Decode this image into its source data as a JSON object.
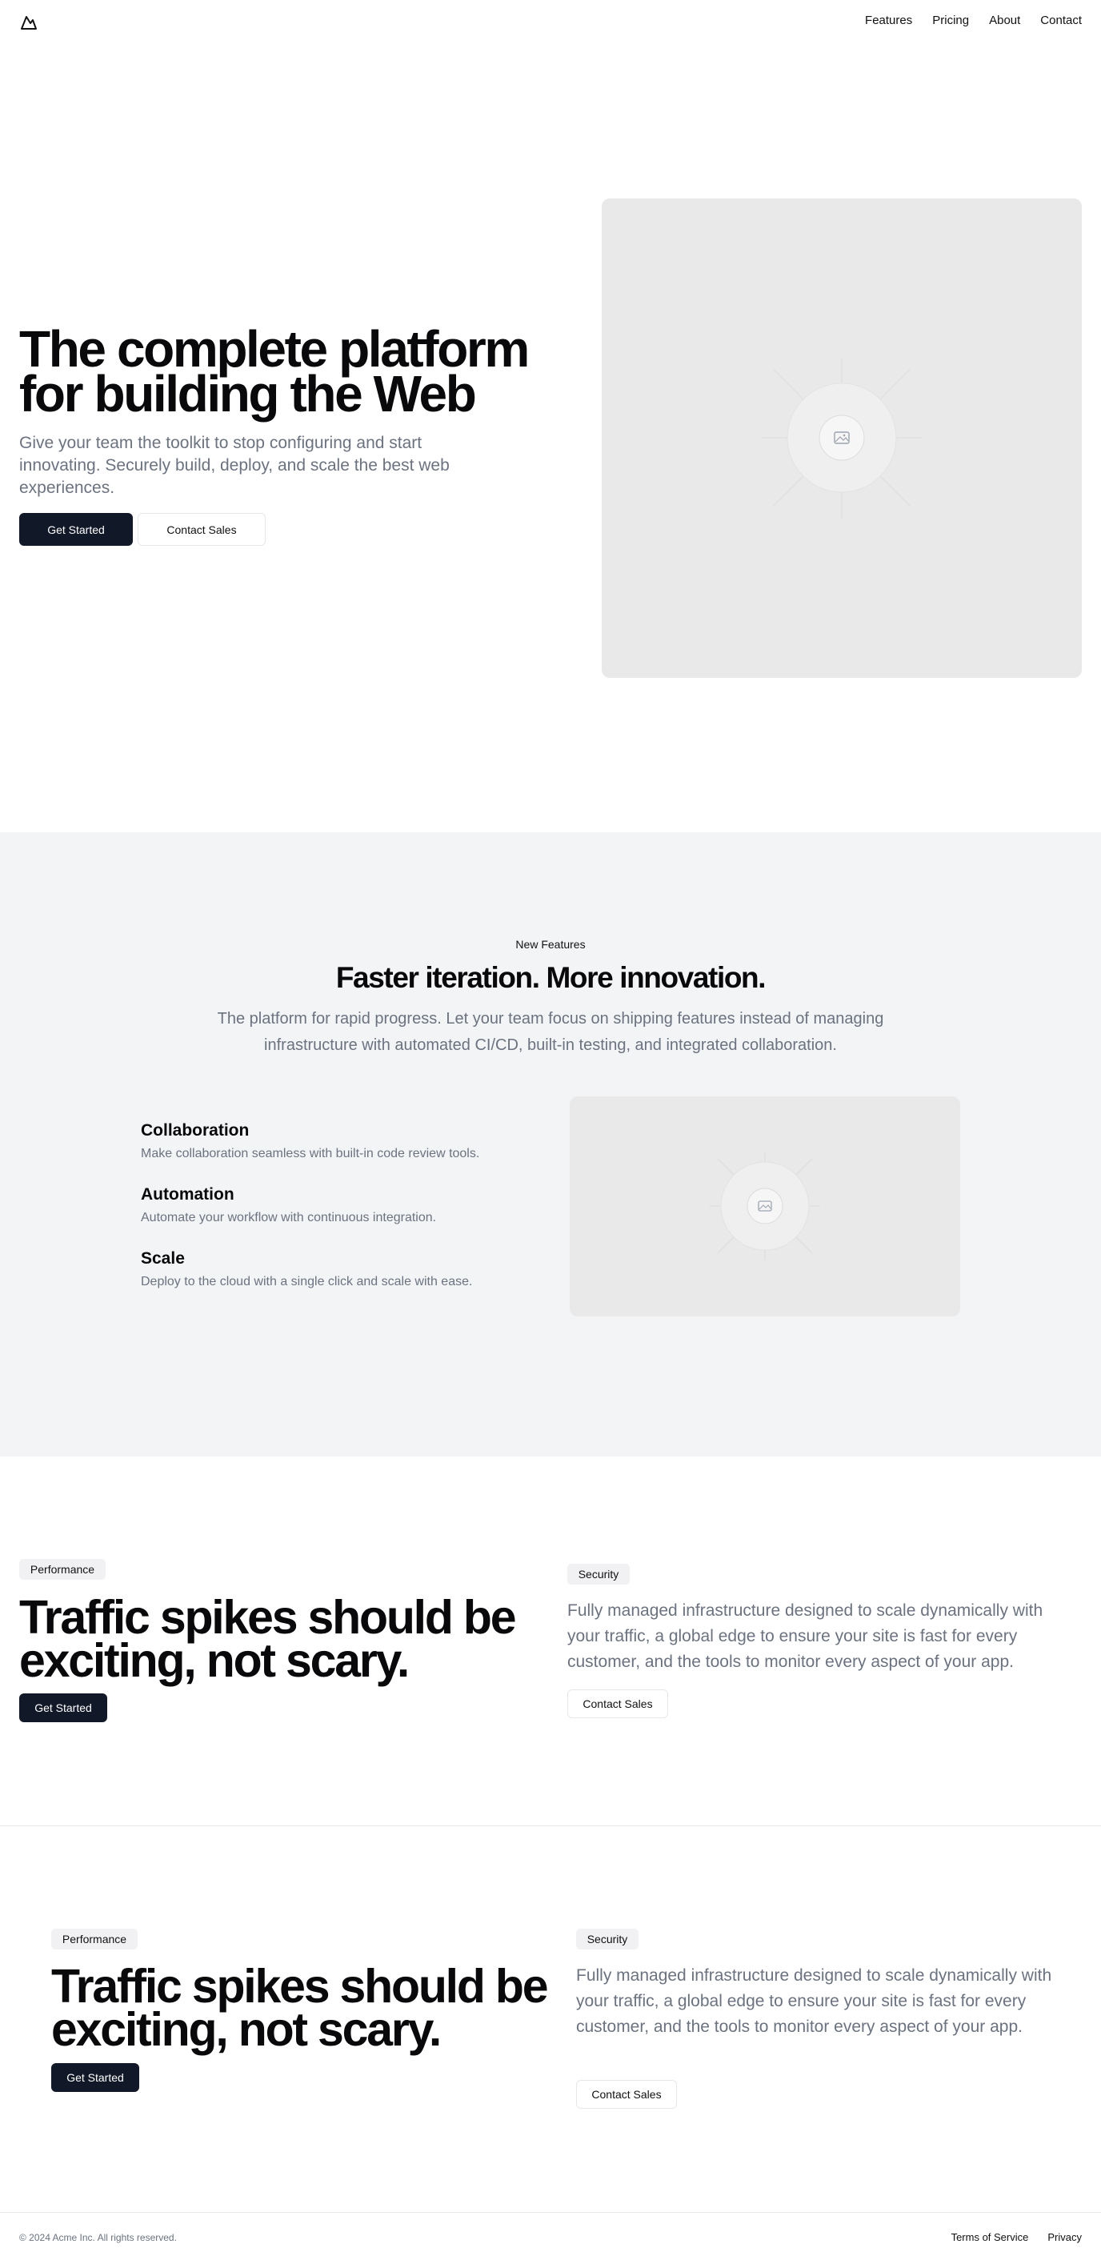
{
  "header": {
    "nav": [
      "Features",
      "Pricing",
      "About",
      "Contact"
    ]
  },
  "hero": {
    "title": "The complete platform for building the Web",
    "subtitle": "Give your team the toolkit to stop configuring and start innovating. Securely build, deploy, and scale the best web experiences.",
    "primary_button": "Get Started",
    "secondary_button": "Contact Sales"
  },
  "features": {
    "eyebrow": "New Features",
    "title": "Faster iteration. More innovation.",
    "subtitle": "The platform for rapid progress. Let your team focus on shipping features instead of managing infrastructure with automated CI/CD, built-in testing, and integrated collaboration.",
    "items": [
      {
        "title": "Collaboration",
        "description": "Make collaboration seamless with built-in code review tools."
      },
      {
        "title": "Automation",
        "description": "Automate your workflow with continuous integration."
      },
      {
        "title": "Scale",
        "description": "Deploy to the cloud with a single click and scale with ease."
      }
    ]
  },
  "cta1": {
    "badge_left": "Performance",
    "title": "Traffic spikes should be exciting, not scary.",
    "primary_button": "Get Started",
    "badge_right": "Security",
    "text": "Fully managed infrastructure designed to scale dynamically with your traffic, a global edge to ensure your site is fast for every customer, and the tools to monitor every aspect of your app.",
    "secondary_button": "Contact Sales"
  },
  "cta2": {
    "badge_left": "Performance",
    "title": "Traffic spikes should be exciting, not scary.",
    "primary_button": "Get Started",
    "badge_right": "Security",
    "text": "Fully managed infrastructure designed to scale dynamically with your traffic, a global edge to ensure your site is fast for every customer, and the tools to monitor every aspect of your app.",
    "secondary_button": "Contact Sales"
  },
  "footer": {
    "copyright": "© 2024 Acme Inc. All rights reserved.",
    "links": [
      "Terms of Service",
      "Privacy"
    ]
  },
  "icons": {
    "logo": "mountain-icon",
    "placeholder": "image-placeholder-icon"
  }
}
